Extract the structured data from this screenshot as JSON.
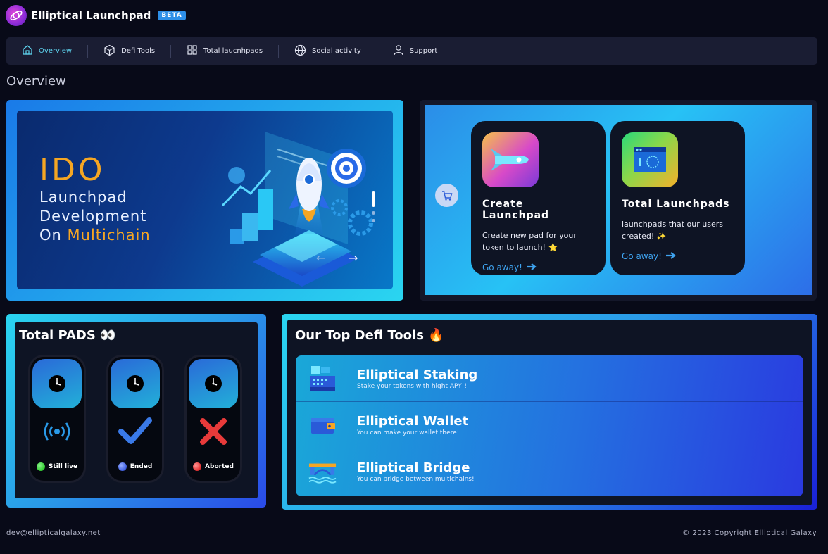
{
  "header": {
    "app_title": "Elliptical Launchpad",
    "badge": "BETA",
    "logo_icon": "elliptical-galaxy-logo"
  },
  "nav": {
    "items": [
      {
        "label": "Overview",
        "icon": "home-icon",
        "active": true
      },
      {
        "label": "Defi Tools",
        "icon": "cube-icon",
        "active": false
      },
      {
        "label": "Total laucnhpads",
        "icon": "grid-icon",
        "active": false
      },
      {
        "label": "Social activity",
        "icon": "globe-icon",
        "active": false
      },
      {
        "label": "Support",
        "icon": "user-icon",
        "active": false
      }
    ]
  },
  "page": {
    "title": "Overview"
  },
  "hero": {
    "headline": "IDO",
    "line1": "Launchpad",
    "line2": "Development",
    "line3_prefix": "On ",
    "line3_accent": "Multichain",
    "prev_arrow": "←",
    "next_arrow": "→"
  },
  "launchpad_cards": [
    {
      "title": "Create Launchpad",
      "desc": "Create new pad for your token to launch! ⭐",
      "link": "Go away!",
      "icon": "rocket-icon"
    },
    {
      "title": "Total Launchpads",
      "desc": "launchpads that our users created! ✨",
      "link": "Go away!",
      "icon": "browser-window-icon"
    }
  ],
  "pads": {
    "title": "Total PADS 👀",
    "items": [
      {
        "label": "Still live",
        "led_color": "#3ad13a",
        "status_icon": "broadcast-icon"
      },
      {
        "label": "Ended",
        "led_color": "#4a6ae8",
        "status_icon": "checkmark-icon"
      },
      {
        "label": "Aborted",
        "led_color": "#e83a3a",
        "status_icon": "cross-icon"
      }
    ]
  },
  "tools": {
    "title": "Our Top Defi Tools 🔥",
    "items": [
      {
        "name": "Elliptical Staking",
        "desc": "Stake your tokens with hight APY!!",
        "icon": "cash-register-icon"
      },
      {
        "name": "Elliptical Wallet",
        "desc": "You can make your wallet there!",
        "icon": "wallet-icon"
      },
      {
        "name": "Elliptical Bridge",
        "desc": "You can bridge between multichains!",
        "icon": "bridge-icon"
      }
    ]
  },
  "footer": {
    "email": "dev@ellipticalgalaxy.net",
    "copyright": "© 2023 Copyright Elliptical Galaxy"
  },
  "colors": {
    "background": "#080a18",
    "accent_cyan": "#5fd5f0",
    "accent_orange": "#f5a623",
    "link_blue": "#3fa4f0"
  }
}
